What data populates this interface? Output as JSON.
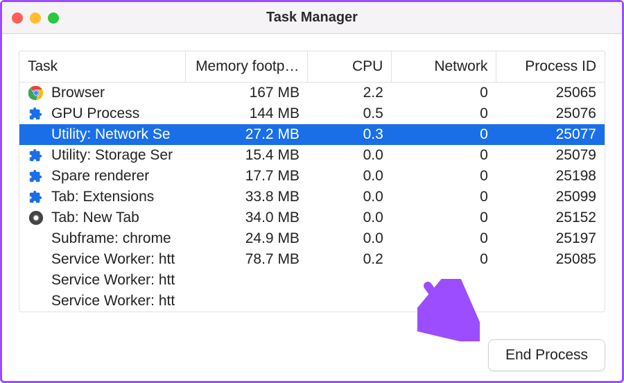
{
  "window": {
    "title": "Task Manager"
  },
  "columns": {
    "task": "Task",
    "memory": "Memory footp…",
    "cpu": "CPU",
    "network": "Network",
    "pid": "Process ID"
  },
  "rows": [
    {
      "icon": "chrome",
      "task": "Browser",
      "memory": "167 MB",
      "cpu": "2.2",
      "network": "0",
      "pid": "25065",
      "selected": false
    },
    {
      "icon": "puzzle",
      "task": "GPU Process",
      "memory": "144 MB",
      "cpu": "0.5",
      "network": "0",
      "pid": "25076",
      "selected": false
    },
    {
      "icon": "puzzle",
      "task": "Utility: Network Se",
      "memory": "27.2 MB",
      "cpu": "0.3",
      "network": "0",
      "pid": "25077",
      "selected": true
    },
    {
      "icon": "puzzle",
      "task": "Utility: Storage Ser",
      "memory": "15.4 MB",
      "cpu": "0.0",
      "network": "0",
      "pid": "25079",
      "selected": false
    },
    {
      "icon": "puzzle",
      "task": "Spare renderer",
      "memory": "17.7 MB",
      "cpu": "0.0",
      "network": "0",
      "pid": "25198",
      "selected": false
    },
    {
      "icon": "puzzle",
      "task": "Tab: Extensions",
      "memory": "33.8 MB",
      "cpu": "0.0",
      "network": "0",
      "pid": "25099",
      "selected": false
    },
    {
      "icon": "chrome-gray",
      "task": "Tab: New Tab",
      "memory": "34.0 MB",
      "cpu": "0.0",
      "network": "0",
      "pid": "25152",
      "selected": false
    },
    {
      "icon": "none",
      "task": "Subframe: chrome",
      "memory": "24.9 MB",
      "cpu": "0.0",
      "network": "0",
      "pid": "25197",
      "selected": false
    },
    {
      "icon": "none",
      "task": "Service Worker: htt",
      "memory": "78.7 MB",
      "cpu": "0.2",
      "network": "0",
      "pid": "25085",
      "selected": false
    },
    {
      "icon": "none",
      "task": "Service Worker: htt",
      "memory": "",
      "cpu": "",
      "network": "",
      "pid": "",
      "selected": false
    },
    {
      "icon": "none",
      "task": "Service Worker: htt",
      "memory": "",
      "cpu": "",
      "network": "",
      "pid": "",
      "selected": false
    }
  ],
  "footer": {
    "end_process": "End Process"
  },
  "colors": {
    "selection": "#1a6fe8",
    "annotation": "#9b4dff"
  }
}
